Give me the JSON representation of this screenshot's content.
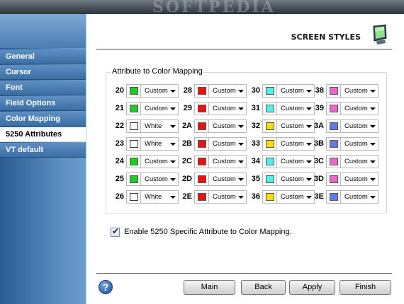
{
  "window": {
    "watermark": "SOFTPEDIA"
  },
  "sidebar": {
    "items": [
      {
        "label": "General",
        "active": false
      },
      {
        "label": "Cursor",
        "active": false
      },
      {
        "label": "Font",
        "active": false
      },
      {
        "label": "Field Options",
        "active": false
      },
      {
        "label": "Color Mapping",
        "active": false
      },
      {
        "label": "5250 Attributes",
        "active": true
      },
      {
        "label": "VT default",
        "active": false
      }
    ]
  },
  "header": {
    "title": "SCREEN STYLES",
    "icon": "monitor-icon"
  },
  "group": {
    "title": "Attribute to Color Mapping"
  },
  "colors": {
    "green": "#22cc22",
    "red": "#ee1111",
    "cyan": "#55eeee",
    "pink": "#ee66cc",
    "white": "#ffffff",
    "yellow": "#ffdd00",
    "blue": "#6677ee"
  },
  "attributes": {
    "columns": [
      [
        {
          "code": "20",
          "color": "green",
          "value": "Custom"
        },
        {
          "code": "21",
          "color": "green",
          "value": "Custom"
        },
        {
          "code": "22",
          "color": "white",
          "value": "White"
        },
        {
          "code": "23",
          "color": "white",
          "value": "White"
        },
        {
          "code": "24",
          "color": "green",
          "value": "Custom"
        },
        {
          "code": "25",
          "color": "green",
          "value": "Custom"
        },
        {
          "code": "26",
          "color": "white",
          "value": "White"
        }
      ],
      [
        {
          "code": "28",
          "color": "red",
          "value": "Custom"
        },
        {
          "code": "29",
          "color": "red",
          "value": "Custom"
        },
        {
          "code": "2A",
          "color": "red",
          "value": "Custom"
        },
        {
          "code": "2B",
          "color": "red",
          "value": "Custom"
        },
        {
          "code": "2C",
          "color": "red",
          "value": "Custom"
        },
        {
          "code": "2D",
          "color": "red",
          "value": "Custom"
        },
        {
          "code": "2E",
          "color": "red",
          "value": "Custom"
        }
      ],
      [
        {
          "code": "30",
          "color": "cyan",
          "value": "Custom"
        },
        {
          "code": "31",
          "color": "cyan",
          "value": "Custom"
        },
        {
          "code": "32",
          "color": "yellow",
          "value": "Custom"
        },
        {
          "code": "33",
          "color": "yellow",
          "value": "Custom"
        },
        {
          "code": "34",
          "color": "cyan",
          "value": "Custom"
        },
        {
          "code": "35",
          "color": "cyan",
          "value": "Custom"
        },
        {
          "code": "36",
          "color": "yellow",
          "value": "Custom"
        }
      ],
      [
        {
          "code": "38",
          "color": "pink",
          "value": "Custom"
        },
        {
          "code": "39",
          "color": "pink",
          "value": "Custom"
        },
        {
          "code": "3A",
          "color": "blue",
          "value": "Custom"
        },
        {
          "code": "3B",
          "color": "blue",
          "value": "Custom"
        },
        {
          "code": "3C",
          "color": "pink",
          "value": "Custom"
        },
        {
          "code": "3D",
          "color": "pink",
          "value": "Custom"
        },
        {
          "code": "3E",
          "color": "blue",
          "value": "Custom"
        }
      ]
    ]
  },
  "checkbox": {
    "label": "Enable 5250 Specific Attribute to Color Mapping.",
    "checked": true
  },
  "buttons": {
    "main": "Main",
    "back": "Back",
    "apply": "Apply",
    "finish": "Finish",
    "help": "?"
  }
}
